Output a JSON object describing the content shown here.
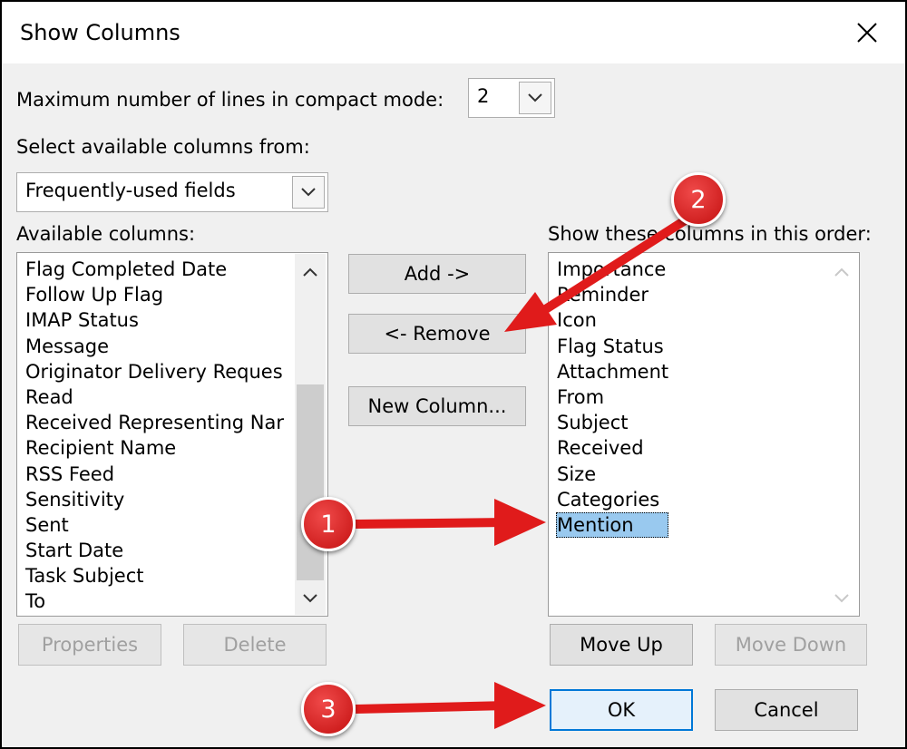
{
  "window": {
    "title": "Show Columns"
  },
  "compact_mode": {
    "label": "Maximum number of lines in compact mode:",
    "value": "2"
  },
  "source": {
    "label": "Select available columns from:",
    "value": "Frequently-used fields"
  },
  "available": {
    "label": "Available columns:",
    "items": [
      "Flag Completed Date",
      "Follow Up Flag",
      "IMAP Status",
      "Message",
      "Originator Delivery Reques",
      "Read",
      "Received Representing Nar",
      "Recipient Name",
      "RSS Feed",
      "Sensitivity",
      "Sent",
      "Start Date",
      "Task Subject",
      "To"
    ]
  },
  "shown": {
    "label": "Show these columns in this order:",
    "items": [
      "Importance",
      "Reminder",
      "Icon",
      "Flag Status",
      "Attachment",
      "From",
      "Subject",
      "Received",
      "Size",
      "Categories",
      "Mention"
    ],
    "selected_index": 10
  },
  "buttons": {
    "add": "Add ->",
    "remove": "<- Remove",
    "new_column": "New Column...",
    "properties": "Properties",
    "delete": "Delete",
    "move_up": "Move Up",
    "move_down": "Move Down",
    "ok": "OK",
    "cancel": "Cancel"
  },
  "annotations": {
    "one": "1",
    "two": "2",
    "three": "3",
    "color": "#e01b1b"
  }
}
